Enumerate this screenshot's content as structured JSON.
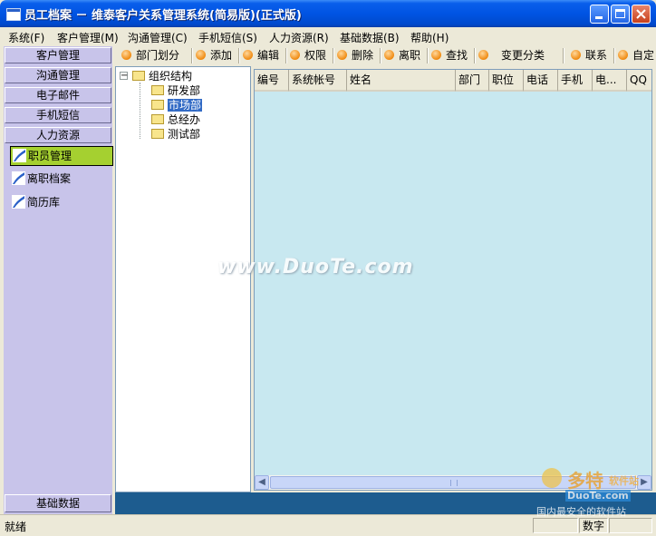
{
  "window": {
    "title": "员工档案 － 维泰客户关系管理系统(简易版)(正式版)"
  },
  "menu": [
    {
      "label": "系统(F)"
    },
    {
      "label": "客户管理(M)"
    },
    {
      "label": "沟通管理(C)"
    },
    {
      "label": "手机短信(S)"
    },
    {
      "label": "人力资源(R)"
    },
    {
      "label": "基础数据(B)"
    },
    {
      "label": "帮助(H)"
    }
  ],
  "leftnav": {
    "buttons": [
      "客户管理",
      "沟通管理",
      "电子邮件",
      "手机短信",
      "人力资源"
    ],
    "subitems": [
      "职员管理",
      "离职档案",
      "简历库"
    ],
    "selected_subitem": "职员管理",
    "bottom_button": "基础数据",
    "colors": {
      "panel": "#C8C4EA",
      "selected": "#A5D030"
    }
  },
  "toolbar": [
    {
      "label": "部门划分",
      "icon": "orange-circle-icon"
    },
    {
      "label": "添加",
      "icon": "orange-circle-icon"
    },
    {
      "label": "编辑",
      "icon": "orange-circle-icon"
    },
    {
      "label": "权限",
      "icon": "orange-circle-icon"
    },
    {
      "label": "删除",
      "icon": "orange-circle-icon"
    },
    {
      "label": "离职",
      "icon": "orange-circle-icon"
    },
    {
      "label": "查找",
      "icon": "orange-circle-icon"
    },
    {
      "label": "变更分类",
      "icon": "orange-circle-icon"
    },
    {
      "label": "联系",
      "icon": "orange-circle-icon"
    },
    {
      "label": "自定",
      "icon": "orange-circle-icon"
    }
  ],
  "tree": {
    "root": "组织结构",
    "children": [
      "研发部",
      "市场部",
      "总经办",
      "测试部"
    ],
    "selected": "市场部",
    "expander": "−"
  },
  "grid": {
    "columns": [
      "编号",
      "系统帐号",
      "姓名",
      "部门",
      "职位",
      "电话",
      "手机",
      "电...",
      "QQ"
    ],
    "rows": [],
    "background": "#C8E8F0"
  },
  "statusbar": {
    "text": "就绪",
    "cells": [
      "",
      "数字",
      ""
    ]
  },
  "watermark": {
    "text": "www.DuoTe.com",
    "logo_main": "多特",
    "logo_sub": "软件站",
    "logo_url": "DuoTe.com",
    "logo_slogan": "国内最安全的软件站"
  }
}
